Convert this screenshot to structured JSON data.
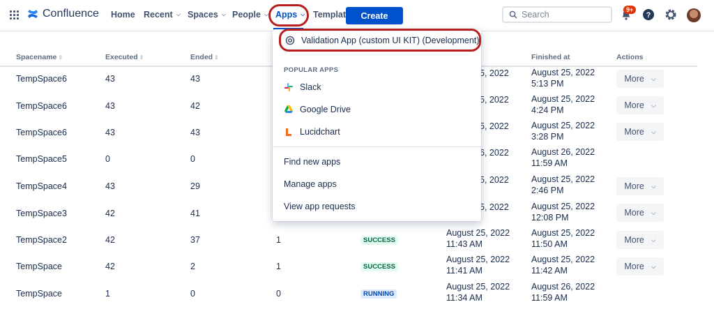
{
  "nav": {
    "app_name": "Confluence",
    "items": [
      {
        "label": "Home"
      },
      {
        "label": "Recent"
      },
      {
        "label": "Spaces"
      },
      {
        "label": "People"
      },
      {
        "label": "Apps"
      },
      {
        "label": "Templates"
      }
    ],
    "create_label": "Create",
    "search_placeholder": "Search",
    "notification_badge": "9+"
  },
  "table": {
    "headers": [
      "Spacename",
      "Executed",
      "Ended",
      "Finished at",
      "Actions"
    ],
    "rows": [
      {
        "space": "TempSpace6",
        "executed": "43",
        "ended": "43",
        "started_tail": "5, 2022",
        "fin_date": "August 25, 2022",
        "fin_time": "5:13 PM",
        "more": "More"
      },
      {
        "space": "TempSpace6",
        "executed": "43",
        "ended": "42",
        "started_tail": "5, 2022",
        "fin_date": "August 25, 2022",
        "fin_time": "4:24 PM",
        "more": "More"
      },
      {
        "space": "TempSpace6",
        "executed": "43",
        "ended": "43",
        "started_tail": "5, 2022",
        "fin_date": "August 25, 2022",
        "fin_time": "3:28 PM",
        "more": "More"
      },
      {
        "space": "TempSpace5",
        "executed": "0",
        "ended": "0",
        "started_tail": "6, 2022",
        "fin_date": "August 26, 2022",
        "fin_time": "11:59 AM",
        "more": ""
      },
      {
        "space": "TempSpace4",
        "executed": "43",
        "ended": "29",
        "started_tail": "5, 2022",
        "fin_date": "August 25, 2022",
        "fin_time": "2:46 PM",
        "more": "More"
      },
      {
        "space": "TempSpace3",
        "executed": "42",
        "ended": "41",
        "started_tail": "5, 2022",
        "fin_date": "August 25, 2022",
        "fin_time": "12:08 PM",
        "more": "More"
      },
      {
        "space": "TempSpace2",
        "executed": "42",
        "ended": "37",
        "col4": "1",
        "status": "SUCCESS",
        "start_date": "August 25, 2022",
        "start_time": "11:43 AM",
        "fin_date": "August 25, 2022",
        "fin_time": "11:50 AM",
        "more": "More"
      },
      {
        "space": "TempSpace",
        "executed": "42",
        "ended": "2",
        "col4": "1",
        "status": "SUCCESS",
        "start_date": "August 25, 2022",
        "start_time": "11:41 AM",
        "fin_date": "August 25, 2022",
        "fin_time": "11:42 AM",
        "more": "More"
      },
      {
        "space": "TempSpace",
        "executed": "1",
        "ended": "0",
        "col4": "0",
        "status": "RUNNING",
        "start_date": "August 25, 2022",
        "start_time": "11:34 AM",
        "fin_date": "August 26, 2022",
        "fin_time": "11:59 AM",
        "more": ""
      }
    ]
  },
  "apps_menu": {
    "top_item": "Validation App (custom UI KIT) (Development)",
    "section_title": "POPULAR APPS",
    "popular": [
      {
        "label": "Slack",
        "icon": "slack-icon"
      },
      {
        "label": "Google Drive",
        "icon": "google-drive-icon"
      },
      {
        "label": "Lucidchart",
        "icon": "lucidchart-icon"
      }
    ],
    "footer": [
      {
        "label": "Find new apps"
      },
      {
        "label": "Manage apps"
      },
      {
        "label": "View app requests"
      }
    ]
  },
  "colors": {
    "brand_blue": "#0052cc",
    "annotation_red": "#b5201d",
    "success_text": "#006644",
    "running_text": "#0747a6"
  }
}
